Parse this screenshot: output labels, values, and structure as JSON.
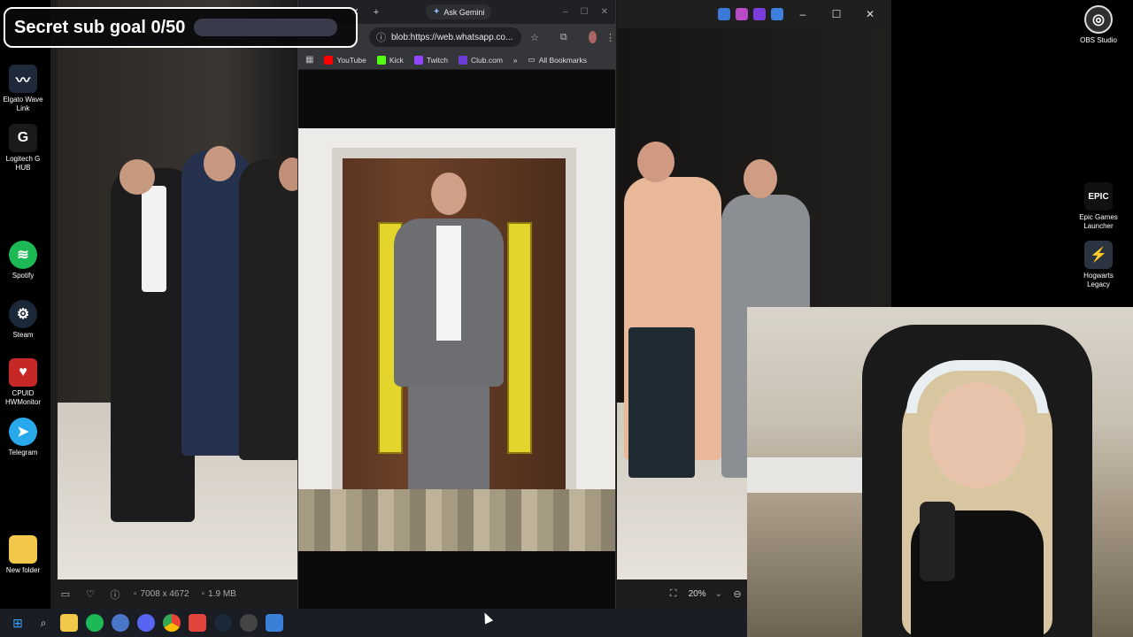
{
  "desktop": {
    "left_icons": [
      {
        "label": "Elgato Wave Link",
        "icon": "wave-link-icon",
        "color": "#1e2a3a"
      },
      {
        "label": "Logitech G HUB",
        "icon": "logitech-g-icon",
        "color": "#1a1a1a"
      },
      {
        "label": "Spotify",
        "icon": "spotify-icon",
        "color": "#1db954"
      },
      {
        "label": "Steam",
        "icon": "steam-icon",
        "color": "#1b2838"
      },
      {
        "label": "CPUID HWMonitor",
        "icon": "hwmonitor-icon",
        "color": "#c62828"
      },
      {
        "label": "Telegram",
        "icon": "telegram-icon",
        "color": "#29a9eb"
      },
      {
        "label": "New folder",
        "icon": "folder-icon",
        "color": "#f2c84b"
      }
    ],
    "right_icons": [
      {
        "label": "OBS Studio",
        "icon": "obs-icon",
        "color": "#302e31"
      },
      {
        "label": "Epic Games Launcher",
        "icon": "epic-games-icon",
        "color": "#111111",
        "glyph": "EPIC"
      },
      {
        "label": "Hogwarts Legacy",
        "icon": "hogwarts-legacy-icon",
        "color": "#2b3440"
      }
    ]
  },
  "subgoal": {
    "text": "Secret sub goal 0/50",
    "progress": 0,
    "bar_color": "#8a7cff"
  },
  "browser": {
    "gemini_label": "Ask Gemini",
    "url": "blob:https://web.whatsapp.co...",
    "bookmarks": [
      {
        "label": "YouTube",
        "icon": "youtube-icon",
        "color": "#ff0000"
      },
      {
        "label": "Kick",
        "icon": "kick-icon",
        "color": "#53fc18"
      },
      {
        "label": "Twitch",
        "icon": "twitch-icon",
        "color": "#9146ff"
      },
      {
        "label": "Club.com",
        "icon": "club-icon",
        "color": "#6b3fd4"
      }
    ],
    "all_bookmarks_label": "All Bookmarks"
  },
  "viewer": {
    "dimensions": "7008 x 4672",
    "file_size": "1.9 MB",
    "zoom": "20%"
  }
}
